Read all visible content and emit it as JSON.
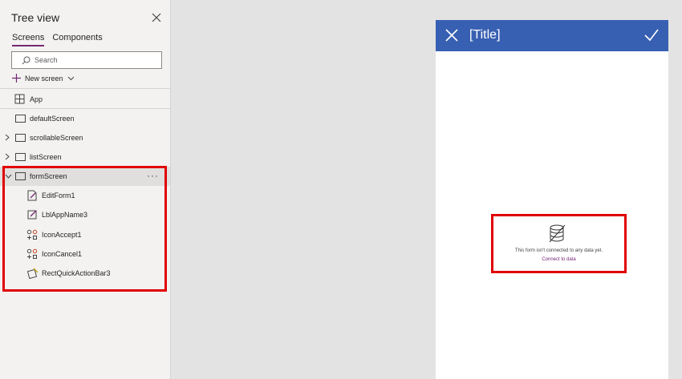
{
  "tree_view": {
    "title": "Tree view",
    "tabs": [
      {
        "label": "Screens",
        "active": true
      },
      {
        "label": "Components",
        "active": false
      }
    ],
    "search_placeholder": "Search",
    "new_screen_label": "New screen",
    "app_label": "App",
    "screens": [
      {
        "label": "defaultScreen",
        "expandable": false
      },
      {
        "label": "scrollableScreen",
        "expandable": true
      },
      {
        "label": "listScreen",
        "expandable": true
      },
      {
        "label": "formScreen",
        "expandable": true,
        "expanded": true,
        "selected": true
      }
    ],
    "form_children": [
      {
        "label": "EditForm1",
        "icon": "edit-form-icon"
      },
      {
        "label": "LblAppName3",
        "icon": "label-icon"
      },
      {
        "label": "IconAccept1",
        "icon": "icon-control-icon"
      },
      {
        "label": "IconCancel1",
        "icon": "icon-control-icon"
      },
      {
        "label": "RectQuickActionBar3",
        "icon": "rectangle-icon"
      }
    ]
  },
  "canvas": {
    "header_title": "[Title]",
    "header_color": "#3860b2",
    "form_message": "This form isn't connected to any data yet.",
    "connect_link": "Connect to data"
  },
  "colors": {
    "accent": "#742774",
    "highlight": "#e00000"
  }
}
